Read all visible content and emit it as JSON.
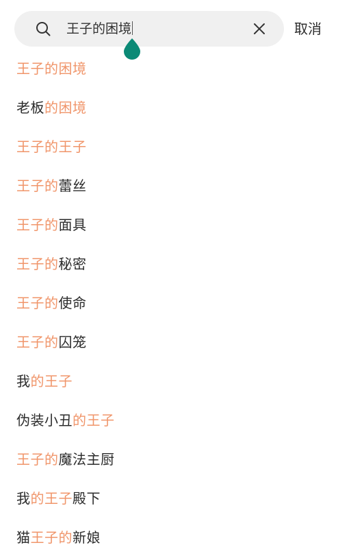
{
  "search": {
    "query": "王子的困境",
    "cancel_label": "取消"
  },
  "icons": {
    "search": "search-icon",
    "clear": "close-icon",
    "cursor_handle": "text-cursor-handle-icon"
  },
  "colors": {
    "highlight": "#f0956a",
    "text": "#2b2b2b",
    "search_background": "#f0f0f0",
    "cursor_handle": "#0b8a76"
  },
  "suggestions": [
    {
      "parts": [
        {
          "text": "王子的困境",
          "hl": true
        }
      ]
    },
    {
      "parts": [
        {
          "text": "老板",
          "hl": false
        },
        {
          "text": "的困境",
          "hl": true
        }
      ]
    },
    {
      "parts": [
        {
          "text": "王子的王子",
          "hl": true
        }
      ]
    },
    {
      "parts": [
        {
          "text": "王子的",
          "hl": true
        },
        {
          "text": "蕾丝",
          "hl": false
        }
      ]
    },
    {
      "parts": [
        {
          "text": "王子的",
          "hl": true
        },
        {
          "text": "面具",
          "hl": false
        }
      ]
    },
    {
      "parts": [
        {
          "text": "王子的",
          "hl": true
        },
        {
          "text": "秘密",
          "hl": false
        }
      ]
    },
    {
      "parts": [
        {
          "text": "王子的",
          "hl": true
        },
        {
          "text": "使命",
          "hl": false
        }
      ]
    },
    {
      "parts": [
        {
          "text": "王子的",
          "hl": true
        },
        {
          "text": "囚笼",
          "hl": false
        }
      ]
    },
    {
      "parts": [
        {
          "text": "我",
          "hl": false
        },
        {
          "text": "的王子",
          "hl": true
        }
      ]
    },
    {
      "parts": [
        {
          "text": "伪装小丑",
          "hl": false
        },
        {
          "text": "的王子",
          "hl": true
        }
      ]
    },
    {
      "parts": [
        {
          "text": "王子的",
          "hl": true
        },
        {
          "text": "魔法主厨",
          "hl": false
        }
      ]
    },
    {
      "parts": [
        {
          "text": "我",
          "hl": false
        },
        {
          "text": "的王子",
          "hl": true
        },
        {
          "text": "殿下",
          "hl": false
        }
      ]
    },
    {
      "parts": [
        {
          "text": "猫",
          "hl": false
        },
        {
          "text": "王子的",
          "hl": true
        },
        {
          "text": "新娘",
          "hl": false
        }
      ]
    }
  ]
}
